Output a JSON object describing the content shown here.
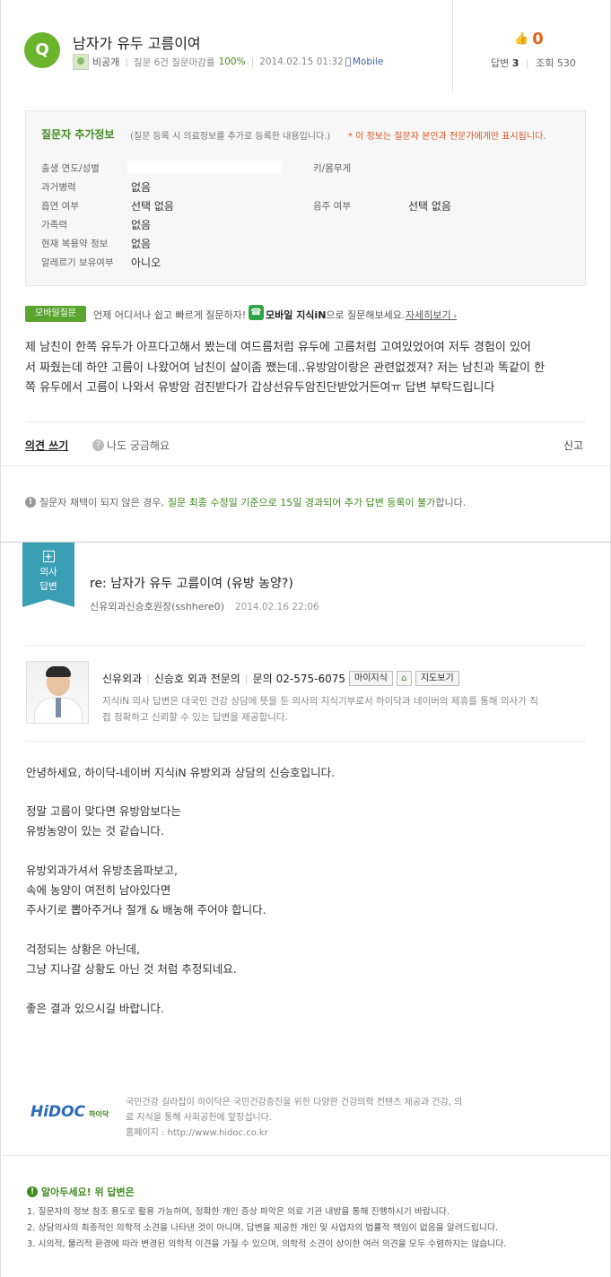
{
  "question": {
    "badge": "Q",
    "title": "남자가 유두 고름이여",
    "author": "비공개",
    "stats_label": "질문 6건 질문마감률",
    "close_rate": "100%",
    "date": "2014.02.15 01:32",
    "device": "Mobile",
    "likes": "0",
    "answers_label": "답변",
    "answers": "3",
    "views_label": "조회",
    "views": "530"
  },
  "extra_info": {
    "title": "질문자 추가정보",
    "subtitle": "(질문 등록 시 의료정보를 추가로 등록한 내용입니다.)",
    "notice": "* 이 정보는 질문자 본인과 전문가에게만 표시됩니다.",
    "fields": [
      {
        "label": "출생 연도/성별",
        "value": ""
      },
      {
        "label": "키/몸무게",
        "value": ""
      },
      {
        "label": "과거병력",
        "value": "없음"
      },
      {
        "label": "흡연 여부",
        "value": "선택 없음"
      },
      {
        "label": "음주 여부",
        "value": "선택 없음"
      },
      {
        "label": "가족력",
        "value": "없음"
      },
      {
        "label": "현재 복용약 정보",
        "value": "없음"
      },
      {
        "label": "알레르기 보유여부",
        "value": "아니오"
      }
    ]
  },
  "mobile_promo": {
    "badge": "모바일질문",
    "text1": "언제 어디서나 쉽고 빠르게 질문하자!",
    "app_name": "모바일 지식iN",
    "text2": "으로 질문해보세요.",
    "link": "자세히보기"
  },
  "question_body": [
    "제 남친이 한쪽 유두가 아프다고해서 봤는데 여드름처럼 유두에 고름처럼 고여있었어여 저두 경험이 있어",
    "서 짜줬는데 하얀 고름이 나왔어여 남친이 샬이좀 쨌는데..유방암이랑은 관련없겠져? 저는 남친과 똑같이 한",
    "쪽 유두에서 고름이 나와서 유방암 검진받다가 갑상선유두암진단받았거든여ㅠ 답변 부탁드립니다"
  ],
  "actions": {
    "write": "의견 쓰기",
    "curious": "나도 궁금해요",
    "report": "신고"
  },
  "policy_notice": {
    "prefix": "질문자 채택이 되지 않은 경우,",
    "highlight": "질문 최종 수정일 기준으로 15일 경과되어 추가 답변 등록이 불가",
    "suffix": "합니다."
  },
  "answer": {
    "ribbon_line1": "의사",
    "ribbon_line2": "답변",
    "title": "re: 남자가 유두 고름이여 (유방 농양?)",
    "author": "신유외과신승호원장(sshhere0)",
    "date": "2014.02.16 22:06",
    "doctor": {
      "clinic": "신유외과",
      "name": "신승호 외과 전문의",
      "contact_label": "문의",
      "phone": "02-575-6075",
      "btn_myjisik": "마이지식",
      "btn_map": "지도보기",
      "desc1": "지식iN 의사 답변은 대국민 건강 상담에 뜻을 둔 의사의 지식기부로서 하이닥과 네이버의 제휴를 통해 의사가 직",
      "desc2": "접 정확하고 신뢰할 수 있는 답변을 제공합니다."
    },
    "body": [
      "안녕하세요, 하이닥-네이버 지식iN 유방외과 상담의 신승호입니다.",
      "정말 고름이 맞다면 유방암보다는",
      "유방농양이 있는 것 같습니다.",
      "유방외과가셔서 유방초음파보고,",
      "속에 농양이 여전히 남아있다면",
      "주사기로 뽑아주거나 절개 & 배농해 주어야 합니다.",
      "걱정되는 상황은 아닌데,",
      "그냥 지나갈 상황도 아닌 것 처럼 추정되네요.",
      "좋은 결과 있으시길 바랍니다."
    ]
  },
  "hidoc": {
    "logo": "HiDOC",
    "logo_sub": "하이닥",
    "line1": "국민건강 길라잡이 하이닥은 국민건강증진을 위한 다양한 건강의학 컨텐츠 제공과 건강, 의",
    "line2": "료 지식을 통해 사회공헌에 앞장섭니다.",
    "line3": "홈페이지 : http://www.hidoc.co.kr"
  },
  "warning": {
    "title": "알아두세요! 위 답변은",
    "items": [
      "1.  질문자의 정보 참조 용도로 활용 가능하며, 정확한 개인 증상 파악은 의료 기관 내방을 통해 진행하시기 바랍니다.",
      "2.  상담의사의 최종적인 의학적 소견을 나타낸 것이 아니며, 답변을 제공한 개인 및 사업자의 법률적 책임이 없음을 알려드립니다.",
      "3.  시의적, 물리적 환경에 따라 변경된 의학적 이견을 가질 수 있으며, 의학적 소견이 상이한 여러 의견을 모두 수렴하지는 않습니다."
    ]
  }
}
